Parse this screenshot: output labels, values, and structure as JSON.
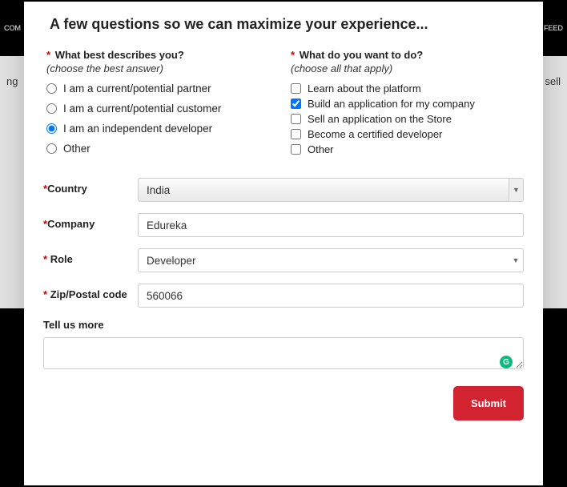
{
  "bg": {
    "left": "COM",
    "right": "FEED",
    "body_left": "ng",
    "body_right": "nd sell"
  },
  "header": {
    "title": "A few questions so we can maximize your experience..."
  },
  "questions": {
    "describe": {
      "label": "What best describes you?",
      "hint": "(choose the best answer)",
      "options": [
        "I am a current/potential partner",
        "I am a current/potential customer",
        "I am an independent developer",
        "Other"
      ],
      "selected": 2
    },
    "want": {
      "label": "What do you want to do?",
      "hint": "(choose all that apply)",
      "options": [
        "Learn about the platform",
        "Build an application for my company",
        "Sell an application on the Store",
        "Become a certified developer",
        "Other"
      ],
      "checked": [
        false,
        true,
        false,
        false,
        false
      ]
    }
  },
  "fields": {
    "country": {
      "label": "Country",
      "value": "India"
    },
    "company": {
      "label": "Company",
      "value": "Edureka"
    },
    "role": {
      "label": "Role",
      "value": "Developer"
    },
    "zip": {
      "label": "Zip/Postal code",
      "value": "560066"
    },
    "more": {
      "label": "Tell us more",
      "value": ""
    }
  },
  "buttons": {
    "submit": "Submit"
  },
  "icons": {
    "grammarly": "G"
  },
  "colors": {
    "required": "#c00",
    "primary": "#d22430"
  }
}
